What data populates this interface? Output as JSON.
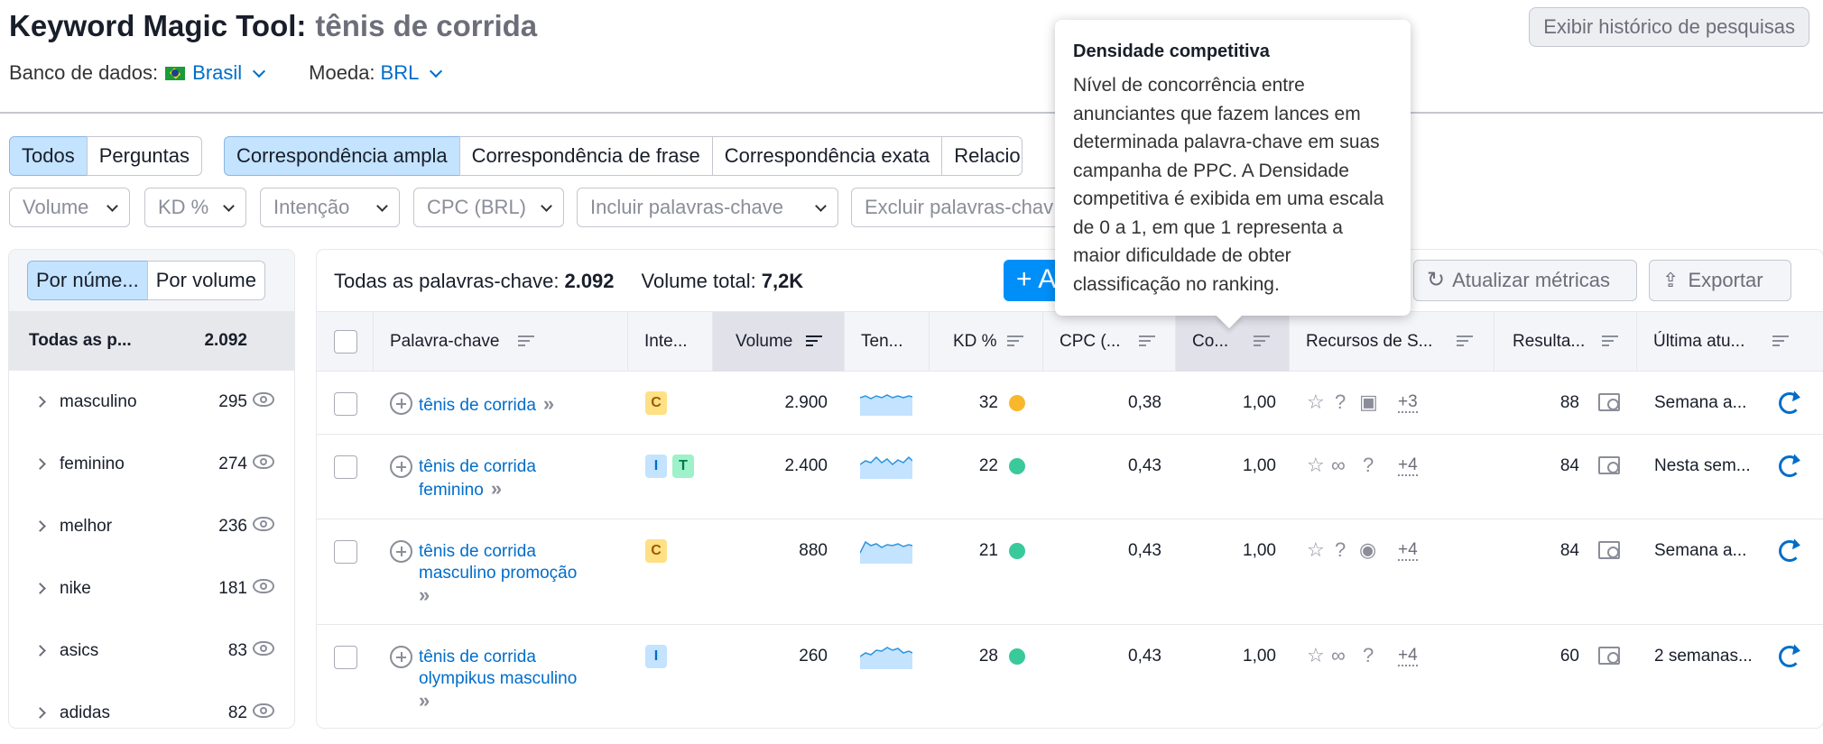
{
  "header": {
    "title": "Keyword Magic Tool:",
    "query": "tênis de corrida",
    "history_button": "Exibir histórico de pesquisas",
    "db_label": "Banco de dados:",
    "db_value": "Brasil",
    "currency_label": "Moeda:",
    "currency_value": "BRL"
  },
  "match_tabs": [
    "Todos",
    "Perguntas"
  ],
  "match_tabs2": [
    "Correspondência ampla",
    "Correspondência de frase",
    "Correspondência exata",
    "Relacio"
  ],
  "filters": [
    "Volume",
    "KD %",
    "Intenção",
    "CPC (BRL)",
    "Incluir palavras-chave",
    "Excluir palavras-chav"
  ],
  "sidebar": {
    "seg_number": "Por núme...",
    "seg_volume": "Por volume",
    "all_label": "Todas as p...",
    "all_count": "2.092",
    "groups": [
      {
        "name": "masculino",
        "count": "295"
      },
      {
        "name": "feminino",
        "count": "274"
      },
      {
        "name": "melhor",
        "count": "236"
      },
      {
        "name": "nike",
        "count": "181"
      },
      {
        "name": "asics",
        "count": "83"
      },
      {
        "name": "adidas",
        "count": "82"
      }
    ]
  },
  "summary": {
    "all_label": "Todas as palavras-chave:",
    "all_count": "2.092",
    "vol_label": "Volume total:",
    "vol_value": "7,2K",
    "add_label": "+  A",
    "update_button": "Atualizar métricas",
    "export_button": "Exportar"
  },
  "columns": {
    "keyword": "Palavra-chave",
    "intent": "Inte...",
    "volume": "Volume",
    "trend": "Ten...",
    "kd": "KD %",
    "cpc": "CPC (...",
    "com": "Co...",
    "serp": "Recursos de S...",
    "results": "Resulta...",
    "updated": "Última atu..."
  },
  "rows": [
    {
      "kw1": "tênis de corrida",
      "kw2": "",
      "kw3": "",
      "intents": [
        "C"
      ],
      "volume": "2.900",
      "kd": "32",
      "kd_color": "#f9b72c",
      "cpc": "0,38",
      "com": "1,00",
      "more": "+3",
      "results": "88",
      "updated": "Semana a..."
    },
    {
      "kw1": "tênis de corrida",
      "kw2": "feminino",
      "kw3": "",
      "intents": [
        "I",
        "T"
      ],
      "volume": "2.400",
      "kd": "22",
      "kd_color": "#3ac99a",
      "cpc": "0,43",
      "com": "1,00",
      "more": "+4",
      "results": "84",
      "updated": "Nesta sem..."
    },
    {
      "kw1": "tênis de corrida",
      "kw2": "masculino promoção",
      "kw3": "",
      "intents": [
        "C"
      ],
      "volume": "880",
      "kd": "21",
      "kd_color": "#3ac99a",
      "cpc": "0,43",
      "com": "1,00",
      "more": "+4",
      "results": "84",
      "updated": "Semana a..."
    },
    {
      "kw1": "tênis de corrida",
      "kw2": "olympikus masculino",
      "kw3": "",
      "intents": [
        "I"
      ],
      "volume": "260",
      "kd": "28",
      "kd_color": "#3ac99a",
      "cpc": "0,43",
      "com": "1,00",
      "more": "+4",
      "results": "60",
      "updated": "2 semanas..."
    }
  ],
  "tooltip": {
    "title": "Densidade competitiva",
    "body": "Nível de concorrência entre anunciantes que fazem lances em determinada palavra-chave em suas campanha de PPC. A Densidade competitiva é exibida em uma escala de 0 a 1, em que 1 representa a maior dificuldade de obter classificação no ranking."
  }
}
